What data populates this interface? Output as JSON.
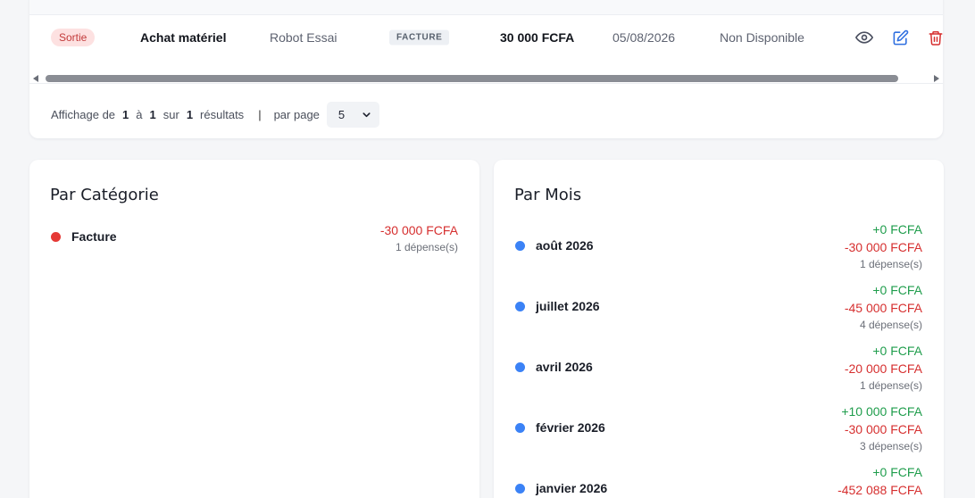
{
  "table": {
    "row": {
      "type_badge": "Sortie",
      "title": "Achat matériel",
      "user": "Robot Essai",
      "category_badge": "FACTURE",
      "amount": "30 000 FCFA",
      "date": "05/08/2026",
      "status": "Non Disponible"
    }
  },
  "pagination": {
    "prefix": "Affichage de",
    "from": "1",
    "to_word": "à",
    "to": "1",
    "of_word": "sur",
    "total": "1",
    "results_word": "résultats",
    "separator": "|",
    "per_page_label": "par page",
    "per_page_value": "5"
  },
  "by_category": {
    "title": "Par Catégorie",
    "items": [
      {
        "name": "Facture",
        "amount": "-30 000 FCFA",
        "count": "1 dépense(s)",
        "color": "#e53935"
      }
    ]
  },
  "by_month": {
    "title": "Par Mois",
    "dot_color": "#3b82f6",
    "items": [
      {
        "name": "août 2026",
        "income": "+0 FCFA",
        "expense": "-30 000 FCFA",
        "count": "1 dépense(s)"
      },
      {
        "name": "juillet 2026",
        "income": "+0 FCFA",
        "expense": "-45 000 FCFA",
        "count": "4 dépense(s)"
      },
      {
        "name": "avril 2026",
        "income": "+0 FCFA",
        "expense": "-20 000 FCFA",
        "count": "1 dépense(s)"
      },
      {
        "name": "février 2026",
        "income": "+10 000 FCFA",
        "expense": "-30 000 FCFA",
        "count": "3 dépense(s)"
      },
      {
        "name": "janvier 2026",
        "income": "+0 FCFA",
        "expense": "-452 088 FCFA",
        "count": ""
      }
    ]
  },
  "colors": {
    "positive": "#1f9d4c",
    "negative": "#d62f2f",
    "accent": "#3b82f6"
  },
  "icons": [
    "eye-icon",
    "edit-icon",
    "trash-icon",
    "chevron-down-icon"
  ]
}
